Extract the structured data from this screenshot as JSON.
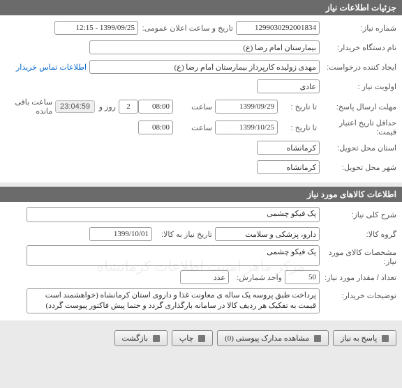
{
  "panel1": {
    "title": "جزئیات اطلاعات نیاز",
    "need_no_lbl": "شماره نیاز:",
    "need_no": "1299030292001834",
    "pub_date_lbl": "تاریخ و ساعت اعلان عمومی:",
    "pub_date": "1399/09/25 - 12:15",
    "buyer_lbl": "نام دستگاه خریدار:",
    "buyer": "بیمارستان امام رضا (ع)",
    "creator_lbl": "ایجاد کننده درخواست:",
    "creator": "مهدی زولیده کارپرداز بیمارستان امام رضا (ع)",
    "contact_link": "اطلاعات تماس خریدار",
    "priority_lbl": "اولویت نیاز :",
    "priority": "عادی",
    "deadline_lbl": "مهلت ارسال پاسخ:",
    "to_date_lbl": "تا تاریخ :",
    "deadline_date": "1399/09/29",
    "time_lbl": "ساعت",
    "deadline_time": "08:00",
    "days": "2",
    "days_lbl": "روز و",
    "remain_time": "23:04:59",
    "remain_lbl": "ساعت باقی مانده",
    "minvalid_lbl": "حداقل تاریخ اعتبار قیمت:",
    "minvalid_date": "1399/10/25",
    "minvalid_time": "08:00",
    "province_lbl": "استان محل تحویل:",
    "province": "کرمانشاه",
    "city_lbl": "شهر محل تحویل:",
    "city": "کرمانشاه"
  },
  "panel2": {
    "title": "اطلاعات کالاهای مورد نیاز",
    "gen_desc_lbl": "شرح کلی نیاز:",
    "gen_desc": "پک فیکو چشمی",
    "group_lbl": "گروه کالا:",
    "group": "دارو، پزشکی و سلامت",
    "need_by_lbl": "تاریخ نیاز به کالا:",
    "need_by": "1399/10/01",
    "spec_lbl": "مشخصات کالای مورد نیاز:",
    "spec": "پک فیکو چشمی",
    "qty_lbl": "تعداد / مقدار مورد نیاز:",
    "qty": "50",
    "unit_lbl": "واحد شمارش:",
    "unit": "عدد",
    "notes_lbl": "توضیحات خریدار:",
    "notes": "پرداخت طبق پروسه یک ساله ی معاونت غذا و داروی استان کرمانشاه (خواهشمند است قیمت به تفکیک هر ردیف کالا در سامانه بارگذاری گردد و حتما پیش فاکتور پیوست گردد)"
  },
  "actions": {
    "reply": "پاسخ به نیاز",
    "attachments": "مشاهده مدارک پیوستی",
    "attach_count": "(0)",
    "print": "چاپ",
    "back": "بازگشت"
  },
  "watermark": "مرکز ماهر امنیت اطلاعات کرمانشاه"
}
